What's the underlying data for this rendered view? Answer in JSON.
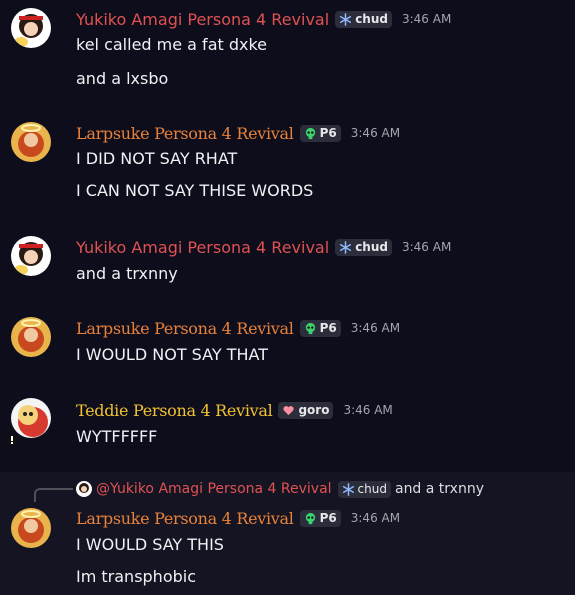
{
  "messages": [
    {
      "author": "Yukiko Amagi Persona 4 Revival",
      "author_color": "#e05252",
      "tag": "chud",
      "tag_icon": "snowflake-icon",
      "time": "3:46 AM",
      "lines": [
        "kel called me a fat dxke",
        "and a lxsbo"
      ]
    },
    {
      "author": "Larpsuke Persona 4 Revival",
      "author_color": "#e8823a",
      "tag": "P6",
      "tag_icon": "skull-icon",
      "time": "3:46 AM",
      "lines": [
        "I DID NOT SAY RHAT",
        "I CAN NOT SAY THISE WORDS"
      ]
    },
    {
      "author": "Yukiko Amagi Persona 4 Revival",
      "author_color": "#e05252",
      "tag": "chud",
      "tag_icon": "snowflake-icon",
      "time": "3:46 AM",
      "lines": [
        "and a trxnny"
      ]
    },
    {
      "author": "Larpsuke Persona 4 Revival",
      "author_color": "#e8823a",
      "tag": "P6",
      "tag_icon": "skull-icon",
      "time": "3:46 AM",
      "lines": [
        "I WOULD NOT SAY THAT"
      ]
    },
    {
      "author": "Teddie Persona 4 Revival",
      "author_color": "#f2c230",
      "tag": "goro",
      "tag_icon": "heart-icon",
      "time": "3:46 AM",
      "lines": [
        "WYTFFFFF"
      ]
    },
    {
      "author": "Larpsuke Persona 4 Revival",
      "author_color": "#e8823a",
      "tag": "P6",
      "tag_icon": "skull-icon",
      "time": "3:46 AM",
      "lines": [
        "I WOULD SAY THIS",
        "Im transphobic"
      ],
      "reply": {
        "author": "@Yukiko Amagi Persona 4 Revival",
        "tag": "chud",
        "text": "and a trxnny"
      }
    }
  ]
}
